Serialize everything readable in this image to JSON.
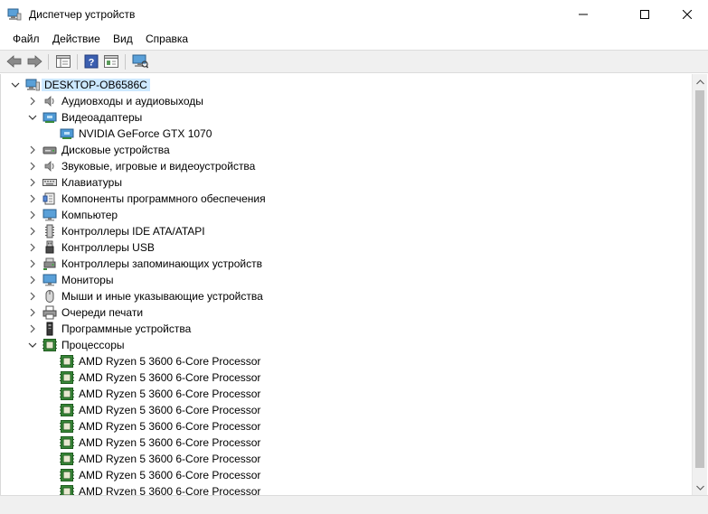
{
  "window": {
    "title": "Диспетчер устройств"
  },
  "menu": [
    {
      "label": "Файл"
    },
    {
      "label": "Действие"
    },
    {
      "label": "Вид"
    },
    {
      "label": "Справка"
    }
  ],
  "tree": {
    "root": {
      "label": "DESKTOP-OB6586C",
      "icon": "computer-icon",
      "expanded": true,
      "selected": true
    },
    "items": [
      {
        "label": "Аудиовходы и аудиовыходы",
        "icon": "speaker-icon",
        "level": 1,
        "expander": "collapsed"
      },
      {
        "label": "Видеоадаптеры",
        "icon": "display-adapter-icon",
        "level": 1,
        "expander": "expanded"
      },
      {
        "label": "NVIDIA GeForce GTX 1070",
        "icon": "display-adapter-icon",
        "level": 2,
        "expander": "none"
      },
      {
        "label": "Дисковые устройства",
        "icon": "disk-drive-icon",
        "level": 1,
        "expander": "collapsed"
      },
      {
        "label": "Звуковые, игровые и видеоустройства",
        "icon": "speaker-icon",
        "level": 1,
        "expander": "collapsed"
      },
      {
        "label": "Клавиатуры",
        "icon": "keyboard-icon",
        "level": 1,
        "expander": "collapsed"
      },
      {
        "label": "Компоненты программного обеспечения",
        "icon": "software-component-icon",
        "level": 1,
        "expander": "collapsed"
      },
      {
        "label": "Компьютер",
        "icon": "monitor-icon",
        "level": 1,
        "expander": "collapsed"
      },
      {
        "label": "Контроллеры IDE ATA/ATAPI",
        "icon": "ide-controller-icon",
        "level": 1,
        "expander": "collapsed"
      },
      {
        "label": "Контроллеры USB",
        "icon": "usb-icon",
        "level": 1,
        "expander": "collapsed"
      },
      {
        "label": "Контроллеры запоминающих устройств",
        "icon": "storage-controller-icon",
        "level": 1,
        "expander": "collapsed"
      },
      {
        "label": "Мониторы",
        "icon": "monitor-icon",
        "level": 1,
        "expander": "collapsed"
      },
      {
        "label": "Мыши и иные указывающие устройства",
        "icon": "mouse-icon",
        "level": 1,
        "expander": "collapsed"
      },
      {
        "label": "Очереди печати",
        "icon": "printer-icon",
        "level": 1,
        "expander": "collapsed"
      },
      {
        "label": "Программные устройства",
        "icon": "software-device-icon",
        "level": 1,
        "expander": "collapsed"
      },
      {
        "label": "Процессоры",
        "icon": "processor-icon",
        "level": 1,
        "expander": "expanded"
      },
      {
        "label": "AMD Ryzen 5 3600 6-Core Processor",
        "icon": "processor-icon",
        "level": 2,
        "expander": "none"
      },
      {
        "label": "AMD Ryzen 5 3600 6-Core Processor",
        "icon": "processor-icon",
        "level": 2,
        "expander": "none"
      },
      {
        "label": "AMD Ryzen 5 3600 6-Core Processor",
        "icon": "processor-icon",
        "level": 2,
        "expander": "none"
      },
      {
        "label": "AMD Ryzen 5 3600 6-Core Processor",
        "icon": "processor-icon",
        "level": 2,
        "expander": "none"
      },
      {
        "label": "AMD Ryzen 5 3600 6-Core Processor",
        "icon": "processor-icon",
        "level": 2,
        "expander": "none"
      },
      {
        "label": "AMD Ryzen 5 3600 6-Core Processor",
        "icon": "processor-icon",
        "level": 2,
        "expander": "none"
      },
      {
        "label": "AMD Ryzen 5 3600 6-Core Processor",
        "icon": "processor-icon",
        "level": 2,
        "expander": "none"
      },
      {
        "label": "AMD Ryzen 5 3600 6-Core Processor",
        "icon": "processor-icon",
        "level": 2,
        "expander": "none"
      },
      {
        "label": "AMD Ryzen 5 3600 6-Core Processor",
        "icon": "processor-icon",
        "level": 2,
        "expander": "none"
      }
    ]
  },
  "colors": {
    "selection": "#cce8ff",
    "toolbar_bg": "#f0f0f0",
    "chip_green": "#3a8a3a"
  }
}
